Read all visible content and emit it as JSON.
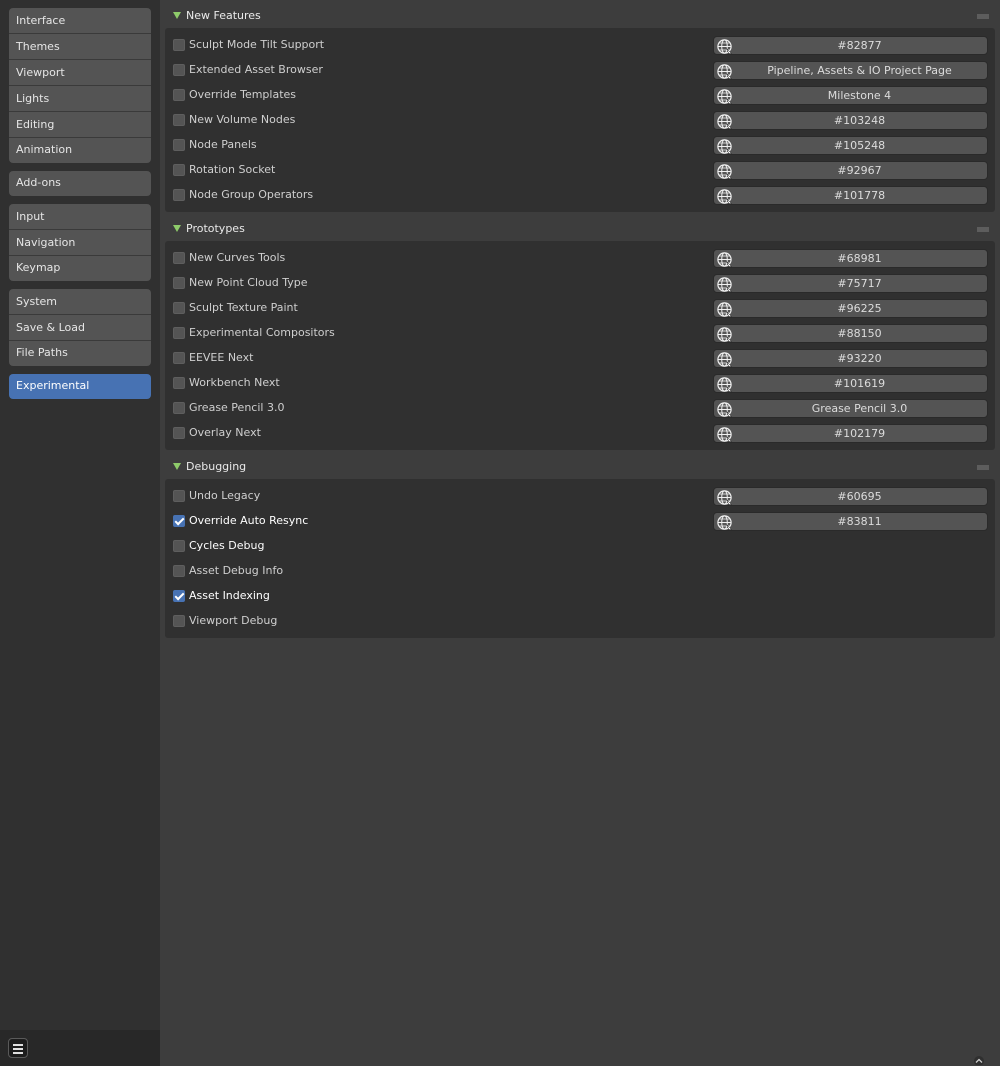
{
  "sidebar": {
    "groups": [
      [
        {
          "label": "Interface"
        },
        {
          "label": "Themes"
        },
        {
          "label": "Viewport"
        },
        {
          "label": "Lights"
        },
        {
          "label": "Editing"
        },
        {
          "label": "Animation"
        }
      ],
      [
        {
          "label": "Add-ons"
        }
      ],
      [
        {
          "label": "Input"
        },
        {
          "label": "Navigation"
        },
        {
          "label": "Keymap"
        }
      ],
      [
        {
          "label": "System"
        },
        {
          "label": "Save & Load"
        },
        {
          "label": "File Paths"
        }
      ],
      [
        {
          "label": "Experimental",
          "active": true
        }
      ]
    ]
  },
  "panels": [
    {
      "title": "New Features",
      "rows": [
        {
          "label": "Sculpt Mode Tilt Support",
          "checked": false,
          "link": "#82877"
        },
        {
          "label": "Extended Asset Browser",
          "checked": false,
          "link": "Pipeline, Assets & IO Project Page"
        },
        {
          "label": "Override Templates",
          "checked": false,
          "link": "Milestone 4"
        },
        {
          "label": "New Volume Nodes",
          "checked": false,
          "link": "#103248"
        },
        {
          "label": "Node Panels",
          "checked": false,
          "link": "#105248"
        },
        {
          "label": "Rotation Socket",
          "checked": false,
          "link": "#92967"
        },
        {
          "label": "Node Group Operators",
          "checked": false,
          "link": "#101778"
        }
      ]
    },
    {
      "title": "Prototypes",
      "rows": [
        {
          "label": "New Curves Tools",
          "checked": false,
          "link": "#68981"
        },
        {
          "label": "New Point Cloud Type",
          "checked": false,
          "link": "#75717"
        },
        {
          "label": "Sculpt Texture Paint",
          "checked": false,
          "link": "#96225"
        },
        {
          "label": "Experimental Compositors",
          "checked": false,
          "link": "#88150"
        },
        {
          "label": "EEVEE Next",
          "checked": false,
          "link": "#93220"
        },
        {
          "label": "Workbench Next",
          "checked": false,
          "link": "#101619"
        },
        {
          "label": "Grease Pencil 3.0",
          "checked": false,
          "link": "Grease Pencil 3.0"
        },
        {
          "label": "Overlay Next",
          "checked": false,
          "link": "#102179"
        }
      ]
    },
    {
      "title": "Debugging",
      "rows": [
        {
          "label": "Undo Legacy",
          "checked": false,
          "link": "#60695"
        },
        {
          "label": "Override Auto Resync",
          "checked": true,
          "link": "#83811"
        },
        {
          "label": "Cycles Debug",
          "checked": false,
          "link": null,
          "highlight": true
        },
        {
          "label": "Asset Debug Info",
          "checked": false,
          "link": null
        },
        {
          "label": "Asset Indexing",
          "checked": true,
          "link": null
        },
        {
          "label": "Viewport Debug",
          "checked": false,
          "link": null
        }
      ]
    }
  ],
  "icons": {
    "panel_toggle": "triangle-down-icon",
    "link": "globe-icon",
    "menu": "hamburger-menu-icon",
    "scroll": "chevron-up-icon"
  },
  "colors": {
    "accent": "#4772b3",
    "panel_arrow": "#8ecb6a"
  }
}
